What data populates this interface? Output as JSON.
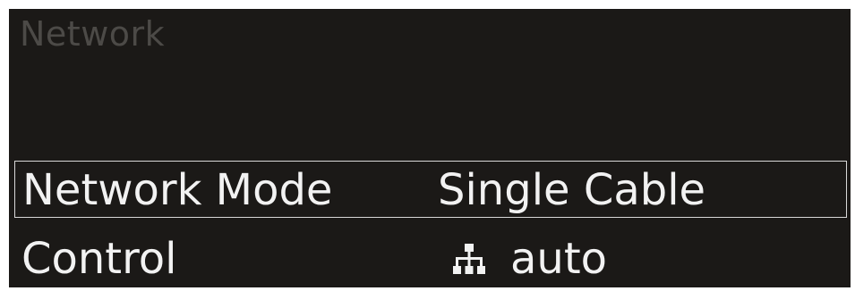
{
  "screen": {
    "title": "Network"
  },
  "menu": {
    "items": [
      {
        "label": "Network Mode",
        "value": "Single Cable",
        "selected": true
      },
      {
        "label": "Control",
        "value": "auto",
        "icon": "network-icon"
      }
    ]
  },
  "colors": {
    "background": "#1b1917",
    "title": "#4c4a47",
    "text": "#f2f2f2",
    "selection_border": "#d8d8d8"
  }
}
